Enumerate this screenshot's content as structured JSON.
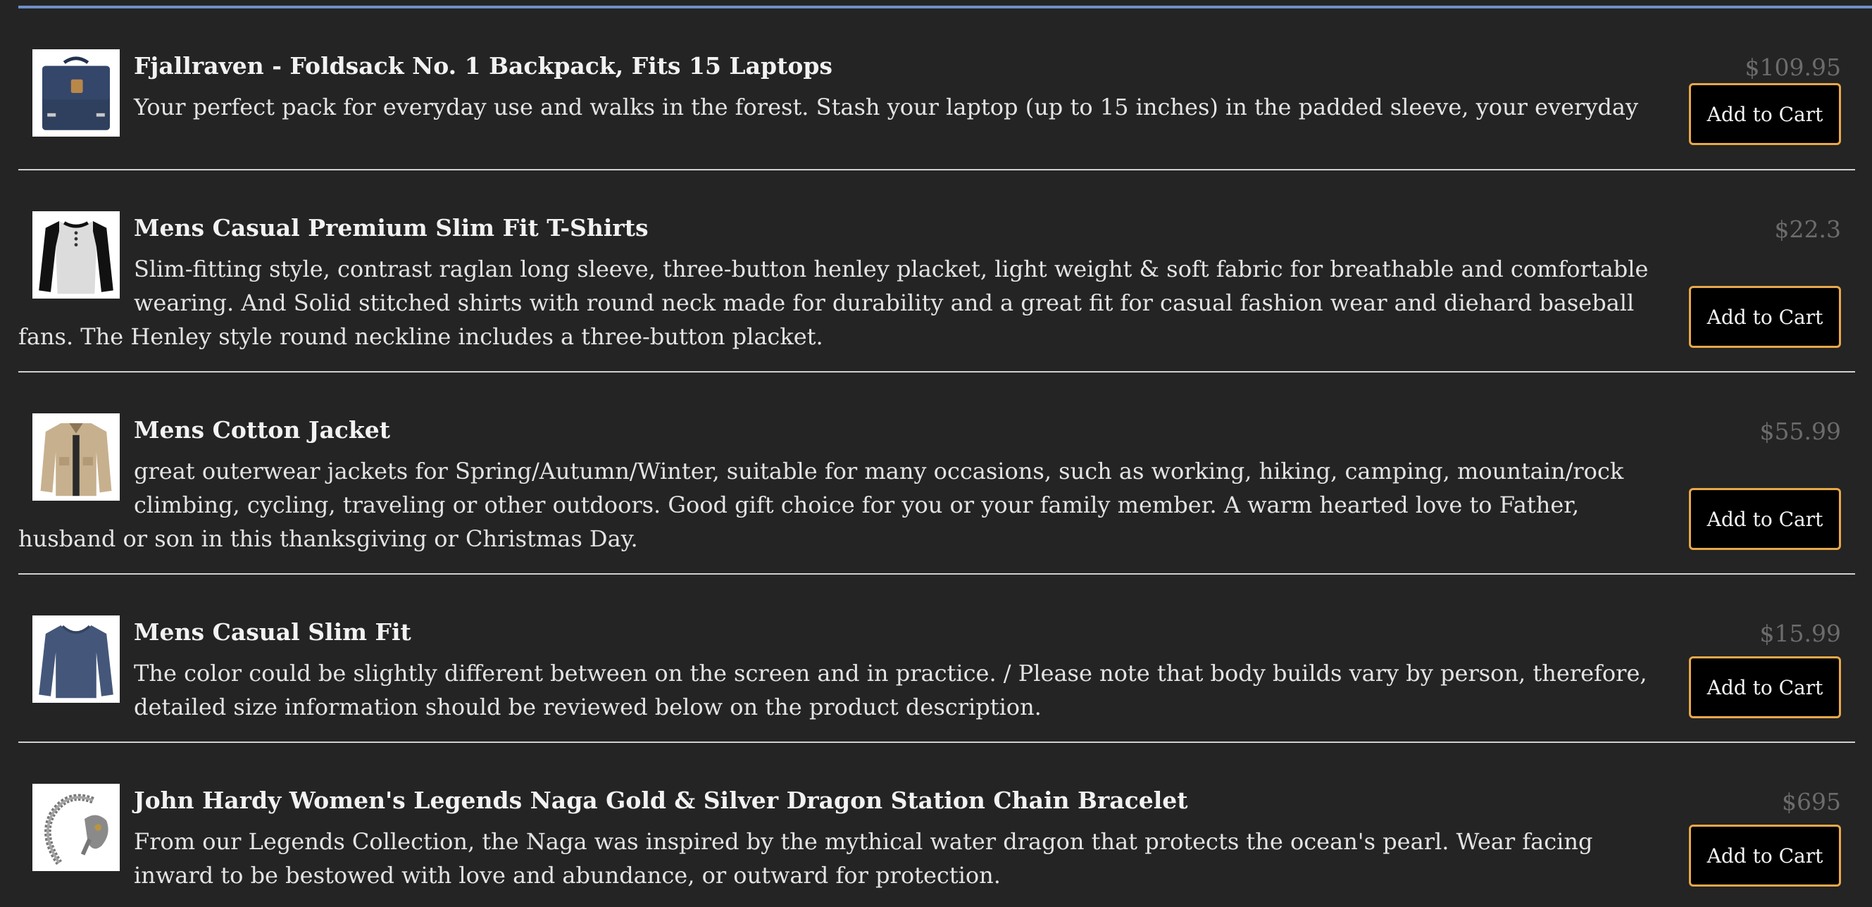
{
  "products": [
    {
      "title": "Fjallraven - Foldsack No. 1 Backpack, Fits 15 Laptops",
      "description": "Your perfect pack for everyday use and walks in the forest. Stash your laptop (up to 15 inches) in the padded sleeve, your everyday",
      "price": "$109.95",
      "button_label": "Add to Cart",
      "image_icon": "backpack-image"
    },
    {
      "title": "Mens Casual Premium Slim Fit T-Shirts",
      "description": "Slim-fitting style, contrast raglan long sleeve, three-button henley placket, light weight & soft fabric for breathable and comfortable wearing. And Solid stitched shirts with round neck made for durability and a great fit for casual fashion wear and diehard baseball fans. The Henley style round neckline includes a three-button placket.",
      "price": "$22.3",
      "button_label": "Add to Cart",
      "image_icon": "raglan-shirt-image"
    },
    {
      "title": "Mens Cotton Jacket",
      "description": "great outerwear jackets for Spring/Autumn/Winter, suitable for many occasions, such as working, hiking, camping, mountain/rock climbing, cycling, traveling or other outdoors. Good gift choice for you or your family member. A warm hearted love to Father, husband or son in this thanksgiving or Christmas Day.",
      "price": "$55.99",
      "button_label": "Add to Cart",
      "image_icon": "jacket-image"
    },
    {
      "title": "Mens Casual Slim Fit",
      "description": "The color could be slightly different between on the screen and in practice. / Please note that body builds vary by person, therefore, detailed size information should be reviewed below on the product description.",
      "price": "$15.99",
      "button_label": "Add to Cart",
      "image_icon": "long-sleeve-shirt-image"
    },
    {
      "title": "John Hardy Women's Legends Naga Gold & Silver Dragon Station Chain Bracelet",
      "description": "From our Legends Collection, the Naga was inspired by the mythical water dragon that protects the ocean's pearl. Wear facing inward to be bestowed with love and abundance, or outward for protection.",
      "price": "$695",
      "button_label": "Add to Cart",
      "image_icon": "bracelet-image"
    }
  ],
  "colors": {
    "background": "#242424",
    "top_rule": "#6e8fc9",
    "button_border": "#e8a849",
    "price_text": "#6c6c6c"
  }
}
